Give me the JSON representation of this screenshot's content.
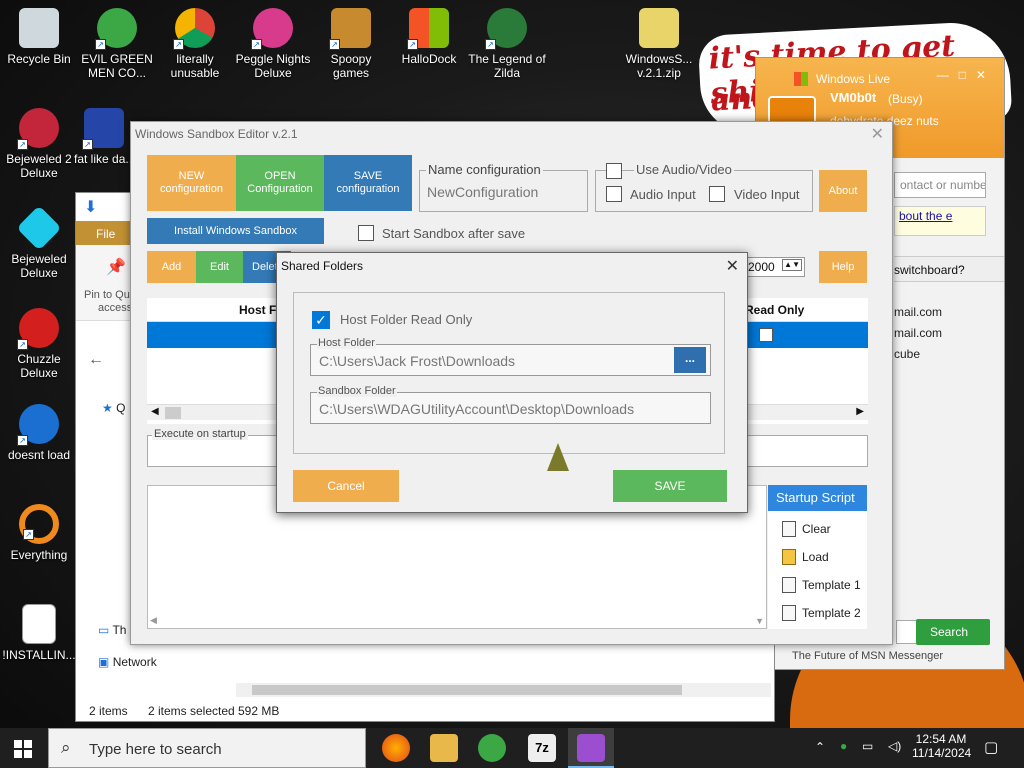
{
  "desktop": {
    "icons": [
      {
        "label": "Recycle Bin"
      },
      {
        "label": "EVIL GREEN MEN CO..."
      },
      {
        "label": "literally unusable"
      },
      {
        "label": "Peggle Nights Deluxe"
      },
      {
        "label": "Spoopy games"
      },
      {
        "label": "HalloDock"
      },
      {
        "label": "The Legend of Zilda"
      },
      {
        "label": "WindowsS... v.2.1.zip"
      },
      {
        "label": "Bejeweled 2 Deluxe"
      },
      {
        "label": "fat like da..."
      },
      {
        "label": "Bejeweled Deluxe"
      },
      {
        "label": "Chuzzle Deluxe"
      },
      {
        "label": "doesnt load"
      },
      {
        "label": "Everything"
      },
      {
        "label": "!INSTALLIN..."
      }
    ],
    "graffiti": [
      "it's time to get shit",
      "and"
    ]
  },
  "msn": {
    "title": "Windows Live",
    "name": "VM0b0t",
    "status": "(Busy)",
    "message": "dehydrate deez nuts",
    "search_placeholder": "ontact or numbe",
    "ad": "bout the e",
    "section": "switchboard?",
    "contacts": [
      "mail.com",
      "mail.com",
      "cube"
    ],
    "search_button": "Search",
    "footer": "The Future of MSN Messenger"
  },
  "explorer": {
    "file_tab": "File",
    "pin_label": "Pin to Qu",
    "pin_label2": "access",
    "nav": [
      "Q",
      "Th",
      "Network"
    ],
    "status_items": "2 items",
    "status_selected": "2 items selected",
    "status_size": "592 MB"
  },
  "editor": {
    "title": "Windows Sandbox Editor v.2.1",
    "buttons": {
      "new": "NEW configuration",
      "open": "OPEN Configuration",
      "save": "SAVE configuration",
      "install": "Install Windows Sandbox",
      "add": "Add",
      "edit": "Edit",
      "delete": "Delet",
      "about": "About",
      "help": "Help"
    },
    "name_config_legend": "Name configuration",
    "name_config_value": "NewConfiguration",
    "audio_video_label": "Use Audio/Video",
    "audio_input": "Audio Input",
    "video_input": "Video Input",
    "start_after_save": "Start Sandbox after save",
    "memory_value": "2000",
    "grid_headers": [
      "Host F",
      "Read Only"
    ],
    "execute_legend": "Execute on startup",
    "side_panel": {
      "title": "Startup Script",
      "items": [
        "Clear",
        "Load",
        "Template 1",
        "Template 2"
      ]
    }
  },
  "dialog": {
    "title": "Shared Folders",
    "read_only_label": "Host Folder Read Only",
    "read_only_checked": true,
    "host_folder_legend": "Host Folder",
    "host_folder_value": "C:\\Users\\Jack Frost\\Downloads",
    "browse_label": "...",
    "sandbox_folder_legend": "Sandbox Folder",
    "sandbox_folder_value": "C:\\Users\\WDAGUtilityAccount\\Desktop\\Downloads",
    "cancel": "Cancel",
    "save": "SAVE"
  },
  "taskbar": {
    "search_placeholder": "Type here to search",
    "time": "12:54 AM",
    "date": "11/14/2024"
  },
  "colors": {
    "orange": "#f0ad4e",
    "green": "#5cb85c",
    "blue": "#337ab7",
    "selection": "#0078d7"
  }
}
